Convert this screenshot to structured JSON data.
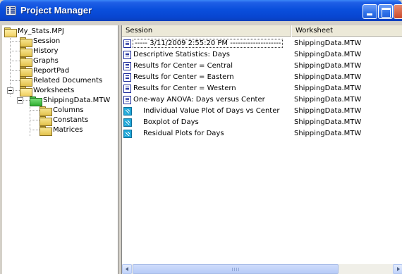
{
  "window": {
    "title": "Project Manager",
    "title_icon": "project-manager-icon",
    "controls": [
      "minimize-icon",
      "maximize-icon",
      "close-icon"
    ]
  },
  "tree": {
    "root": "My_Stats.MPJ",
    "items": [
      {
        "label": "Session",
        "icon": "session-folder-icon"
      },
      {
        "label": "History",
        "icon": "folder-icon"
      },
      {
        "label": "Graphs",
        "icon": "folder-icon"
      },
      {
        "label": "ReportPad",
        "icon": "folder-icon"
      },
      {
        "label": "Related Documents",
        "icon": "folder-icon"
      },
      {
        "label": "Worksheets",
        "icon": "folder-icon"
      }
    ],
    "worksheet": {
      "label": "ShippingData.MTW",
      "icon": "worksheet-folder-icon"
    },
    "worksheet_children": [
      {
        "label": "Columns",
        "icon": "folder-icon"
      },
      {
        "label": "Constants",
        "icon": "folder-icon"
      },
      {
        "label": "Matrices",
        "icon": "folder-icon"
      }
    ]
  },
  "list": {
    "columns": [
      "Session",
      "Worksheet"
    ],
    "rows": [
      {
        "session": "-----  3/11/2009 2:55:20 PM  --------------------",
        "worksheet": "ShippingData.MTW",
        "icon": "document-icon",
        "indent": false,
        "selected": true
      },
      {
        "session": "Descriptive Statistics: Days",
        "worksheet": "ShippingData.MTW",
        "icon": "document-icon",
        "indent": false
      },
      {
        "session": "Results for Center = Central",
        "worksheet": "ShippingData.MTW",
        "icon": "document-icon",
        "indent": false
      },
      {
        "session": "Results for Center = Eastern",
        "worksheet": "ShippingData.MTW",
        "icon": "document-icon",
        "indent": false
      },
      {
        "session": "Results for Center = Western",
        "worksheet": "ShippingData.MTW",
        "icon": "document-icon",
        "indent": false
      },
      {
        "session": "One-way ANOVA: Days versus Center",
        "worksheet": "ShippingData.MTW",
        "icon": "document-icon",
        "indent": false
      },
      {
        "session": "Individual Value Plot of Days vs Center",
        "worksheet": "ShippingData.MTW",
        "icon": "graph-icon",
        "indent": true
      },
      {
        "session": "Boxplot of Days",
        "worksheet": "ShippingData.MTW",
        "icon": "graph-icon",
        "indent": true
      },
      {
        "session": "Residual Plots for Days",
        "worksheet": "ShippingData.MTW",
        "icon": "graph-icon",
        "indent": true
      }
    ]
  },
  "colors": {
    "titlebar": "#0a4fdc",
    "frame": "#d4d0c8",
    "header": "#ece9d8",
    "graph_icon": "#21a8d8",
    "text": "#000000"
  }
}
